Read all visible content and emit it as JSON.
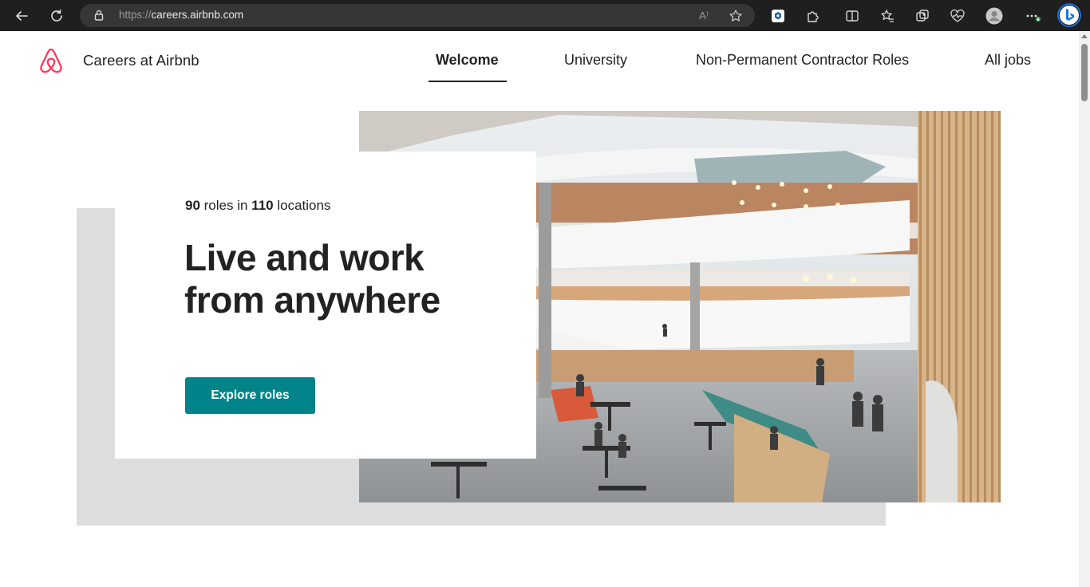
{
  "browser": {
    "url_protocol": "https://",
    "url_host": "careers.airbnb.com",
    "read_aloud_label": "A⁾"
  },
  "site": {
    "brand": "Careers at Airbnb",
    "logo_icon": "airbnb-belo-logo",
    "brand_color": "#ff385c"
  },
  "nav": {
    "items": [
      {
        "label": "Welcome",
        "active": true
      },
      {
        "label": "University",
        "active": false
      },
      {
        "label": "Non-Permanent Contractor Roles",
        "active": false
      },
      {
        "label": "All jobs",
        "active": false
      }
    ]
  },
  "hero": {
    "roles_count": "90",
    "roles_text": " roles in ",
    "locations_count": "110",
    "locations_text": " locations",
    "title_line1": "Live and work",
    "title_line2": "from anywhere",
    "cta_label": "Explore roles",
    "cta_color": "#008489",
    "image_description_icon": "office-atrium-photo"
  }
}
